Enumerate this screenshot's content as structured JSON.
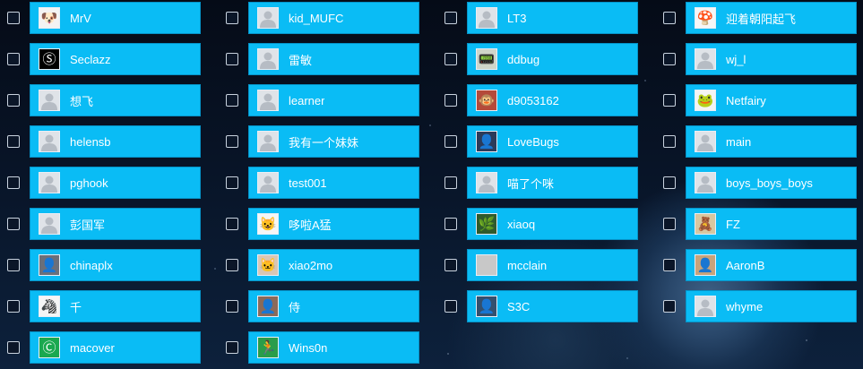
{
  "columns": [
    [
      {
        "name": "MrV",
        "icon": "dog-avatar-icon",
        "glyph": "🐶",
        "bg": "#f3f3f3"
      },
      {
        "name": "Seclazz",
        "icon": "s-logo-icon",
        "glyph": "Ⓢ",
        "bg": "#000000"
      },
      {
        "name": "想飞",
        "icon": "default-avatar-icon",
        "glyph": "",
        "bg": ""
      },
      {
        "name": "helensb",
        "icon": "default-avatar-icon",
        "glyph": "",
        "bg": ""
      },
      {
        "name": "pghook",
        "icon": "default-avatar-icon",
        "glyph": "",
        "bg": ""
      },
      {
        "name": "彭国军",
        "icon": "default-avatar-icon",
        "glyph": "",
        "bg": ""
      },
      {
        "name": "chinaplx",
        "icon": "photo-avatar-icon",
        "glyph": "👤",
        "bg": "#6b6f7a"
      },
      {
        "name": "千",
        "icon": "zebra-avatar-icon",
        "glyph": "🦓",
        "bg": "#f5f5f5"
      },
      {
        "name": "macover",
        "icon": "c-logo-icon",
        "glyph": "Ⓒ",
        "bg": "#1aa84f"
      }
    ],
    [
      {
        "name": "kid_MUFC",
        "icon": "default-avatar-icon",
        "glyph": "",
        "bg": ""
      },
      {
        "name": "雷敏",
        "icon": "default-avatar-icon",
        "glyph": "",
        "bg": ""
      },
      {
        "name": "learner",
        "icon": "default-avatar-icon",
        "glyph": "",
        "bg": ""
      },
      {
        "name": "我有一个妹妹",
        "icon": "default-avatar-icon",
        "glyph": "",
        "bg": ""
      },
      {
        "name": "test001",
        "icon": "default-avatar-icon",
        "glyph": "",
        "bg": ""
      },
      {
        "name": "哆啦A猛",
        "icon": "doraemon-avatar-icon",
        "glyph": "😺",
        "bg": "#f6f6f6"
      },
      {
        "name": "xiao2mo",
        "icon": "cat-avatar-icon",
        "glyph": "🐱",
        "bg": "#d9c6b5"
      },
      {
        "name": "侍",
        "icon": "photo-avatar-icon",
        "glyph": "👤",
        "bg": "#8a6a5a"
      },
      {
        "name": "Wins0n",
        "icon": "runner-avatar-icon",
        "glyph": "🏃",
        "bg": "#2a9d4a"
      }
    ],
    [
      {
        "name": "LT3",
        "icon": "default-avatar-icon",
        "glyph": "",
        "bg": ""
      },
      {
        "name": "ddbug",
        "icon": "device-avatar-icon",
        "glyph": "📟",
        "bg": "#cfd5c9"
      },
      {
        "name": "d9053162",
        "icon": "cartoon-avatar-icon",
        "glyph": "🐵",
        "bg": "#b44a3a"
      },
      {
        "name": "LoveBugs",
        "icon": "photo-avatar-icon",
        "glyph": "👤",
        "bg": "#2b3b5a"
      },
      {
        "name": "喵了个咪",
        "icon": "default-avatar-icon",
        "glyph": "",
        "bg": ""
      },
      {
        "name": "xiaoq",
        "icon": "plant-avatar-icon",
        "glyph": "🌿",
        "bg": "#2f5a2c"
      },
      {
        "name": "mcclain",
        "icon": "photo-avatar-icon",
        "glyph": "",
        "bg": "#c8c8c8"
      },
      {
        "name": "S3C",
        "icon": "photo-avatar-icon",
        "glyph": "👤",
        "bg": "#34506e"
      }
    ],
    [
      {
        "name": "迎着朝阳起飞",
        "icon": "mushroom-avatar-icon",
        "glyph": "🍄",
        "bg": "#f6f6f6"
      },
      {
        "name": "wj_l",
        "icon": "default-avatar-icon",
        "glyph": "",
        "bg": ""
      },
      {
        "name": "Netfairy",
        "icon": "frog-avatar-icon",
        "glyph": "🐸",
        "bg": "#f4f4f4"
      },
      {
        "name": "main",
        "icon": "default-avatar-icon",
        "glyph": "",
        "bg": ""
      },
      {
        "name": "boys_boys_boys",
        "icon": "default-avatar-icon",
        "glyph": "",
        "bg": ""
      },
      {
        "name": "FZ",
        "icon": "cartoon-avatar-icon",
        "glyph": "🧸",
        "bg": "#d8c7a0"
      },
      {
        "name": "AaronB",
        "icon": "photo-avatar-icon",
        "glyph": "👤",
        "bg": "#c9a37a"
      },
      {
        "name": "whyme",
        "icon": "default-avatar-icon",
        "glyph": "",
        "bg": ""
      }
    ]
  ],
  "colors": {
    "bar": "#0abcf5",
    "bar_border": "#0593c8",
    "text": "#ffffff",
    "checkbox_border": "#c9d3df"
  }
}
